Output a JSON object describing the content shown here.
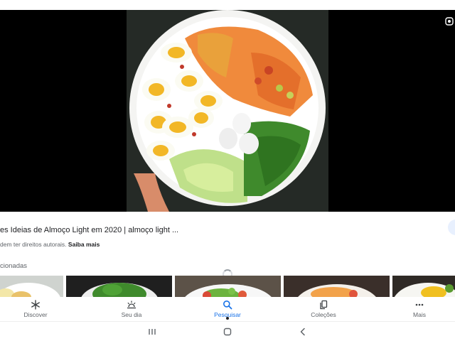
{
  "result": {
    "title": "es Ideias de Almoço Light em 2020 | almoço light ...",
    "caption_prefix": "dem ter direitos autorais.",
    "caption_link": "Saiba mais"
  },
  "related": {
    "label": "cionadas"
  },
  "nav": {
    "items": [
      {
        "label": "Discover",
        "icon": "asterisk-icon"
      },
      {
        "label": "Seu dia",
        "icon": "sun-icon"
      },
      {
        "label": "Pesquisar",
        "icon": "search-icon",
        "active": true
      },
      {
        "label": "Coleções",
        "icon": "collections-icon"
      },
      {
        "label": "Mais",
        "icon": "more-dots-icon"
      }
    ]
  },
  "system_nav": {
    "icons": [
      "recents-icon",
      "home-icon",
      "back-icon"
    ]
  },
  "colors": {
    "accent": "#1a73e8",
    "viewer_bg": "#000000",
    "text_secondary": "#5f6368"
  }
}
